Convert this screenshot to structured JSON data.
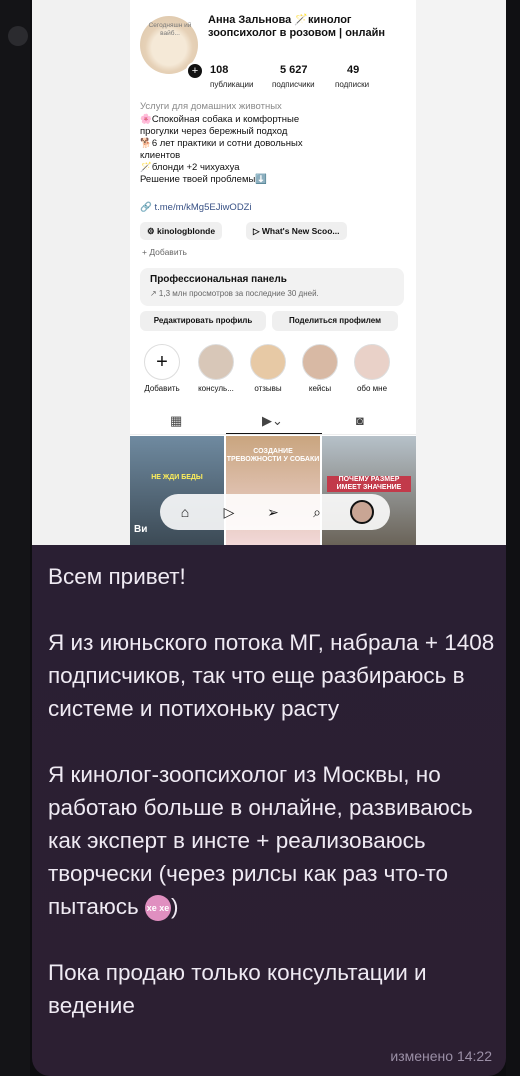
{
  "profile": {
    "avatar_note": "Сегодняшн ий вайб...",
    "name": "Анна Зальнова 🪄кинолог зоопсихолог в розовом | онлайн",
    "stats": [
      {
        "value": "108",
        "label": "публикации"
      },
      {
        "value": "5 627",
        "label": "подписчики"
      },
      {
        "value": "49",
        "label": "подписки"
      }
    ],
    "category": "Услуги для домашних животных",
    "bio": "🌸Спокойная собака и комфортные\nпрогулки через бережный подход\n🐕6 лет практики и сотни довольных\nклиентов\n🪄блонди +2 чихуахуа\nРешение твоей проблемы⬇️",
    "link": "🔗 t.me/m/kMg5EJiwODZi",
    "chips": [
      "⚙ kinologblonde",
      "▷ What's New Scoo..."
    ],
    "add_more": "+ Добавить",
    "panel_title": "Профессиональная панель",
    "panel_sub": "↗ 1,3 млн просмотров за последние 30 дней.",
    "edit_button": "Редактировать профиль",
    "share_button": "Поделиться профилем",
    "highlights": [
      {
        "label": "Добавить",
        "color": "#ffffff"
      },
      {
        "label": "консуль...",
        "color": "#d8c7b8"
      },
      {
        "label": "отзывы",
        "color": "#e7c9a5"
      },
      {
        "label": "кейсы",
        "color": "#d8b9a4"
      },
      {
        "label": "обо мне",
        "color": "#e9d1c8"
      }
    ],
    "grid_texts": [
      "НЕ ЖДИ БЕДЫ",
      "СОЗДАНИЕ ТРЕВОЖНОСТИ У СОБАКИ",
      "ПОЧЕМУ РАЗМЕР ИМЕЕТ ЗНАЧЕНИЕ"
    ],
    "grid_bottom_left": "Ви"
  },
  "message": {
    "paragraphs": [
      "Всем привет!",
      "Я из июньского потока МГ, набрала + 1408 подписчиков,  так что еще разбираюсь в системе и потихоньку расту",
      "Я кинолог-зоопсихолог из Москвы, но работаю больше в онлайне, развиваюсь как эксперт в инсте + реализоваюсь творчески (через рилсы как раз что-то пытаюсь",
      "Пока продаю только консультации и ведение"
    ],
    "emoji_closing": ")",
    "emoji_text": "xe xe",
    "meta": "изменено 14:22"
  }
}
